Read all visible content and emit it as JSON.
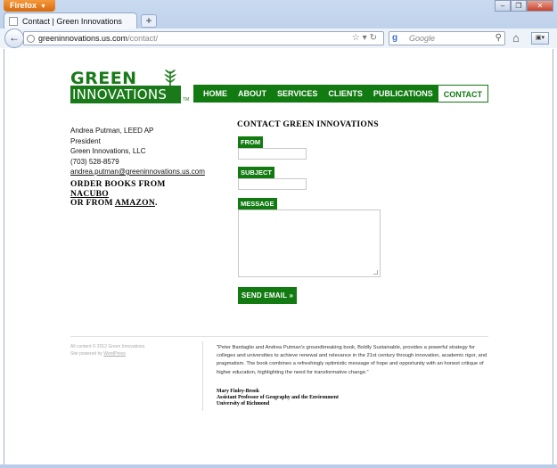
{
  "browser": {
    "app_button": "Firefox",
    "tab_title": "Contact | Green Innovations",
    "url_domain": "greeninnovations.us.com",
    "url_path": "/contact/",
    "search_placeholder": "Google"
  },
  "site": {
    "logo_word_top": "GREEN",
    "logo_word_bottom": "INNOVATIONS",
    "logo_tm": "TM",
    "nav": [
      {
        "label": "HOME",
        "active": false
      },
      {
        "label": "ABOUT",
        "active": false
      },
      {
        "label": "SERVICES",
        "active": false
      },
      {
        "label": "CLIENTS",
        "active": false
      },
      {
        "label": "PUBLICATIONS",
        "active": false
      },
      {
        "label": "CONTACT",
        "active": true
      }
    ]
  },
  "contact": {
    "name": "Andrea Putman, LEED AP",
    "title": "President",
    "company": "Green Innovations, LLC",
    "phone": "(703) 528-8579",
    "email": "andrea.putman@greeninnovations.us.com",
    "order_prefix": "ORDER BOOKS FROM",
    "order_link1": "NACUBO",
    "order_mid": "OR FROM",
    "order_link2": "AMAZON",
    "order_suffix": "."
  },
  "form": {
    "heading": "CONTACT GREEN INNOVATIONS",
    "from_label": "FROM",
    "subject_label": "SUBJECT",
    "message_label": "MESSAGE",
    "from_value": "",
    "subject_value": "",
    "message_value": "",
    "submit_label": "SEND EMAIL »"
  },
  "footer": {
    "copyright": "All content © 2012 Green Innovations.",
    "powered_prefix": "Site powered by",
    "powered_link": "WordPress",
    "quote": "\"Peter Bardaglio and Andrea Putman's groundbreaking book, Boldly Sustainable, provides a powerful strategy for colleges and universities to achieve renewal and relevance in the 21st century through innovation, academic rigor, and pragmatism. The book combines a refreshingly optimistic message of hope and opportunity with an honest critique of higher education, highlighting the need for transformative change.\"",
    "attrib_name": "Mary Finley-Brook",
    "attrib_title": "Assistant Professor of Geography and the Environment",
    "attrib_org": "University of Richmond"
  },
  "colors": {
    "brand_green": "#117a11"
  }
}
